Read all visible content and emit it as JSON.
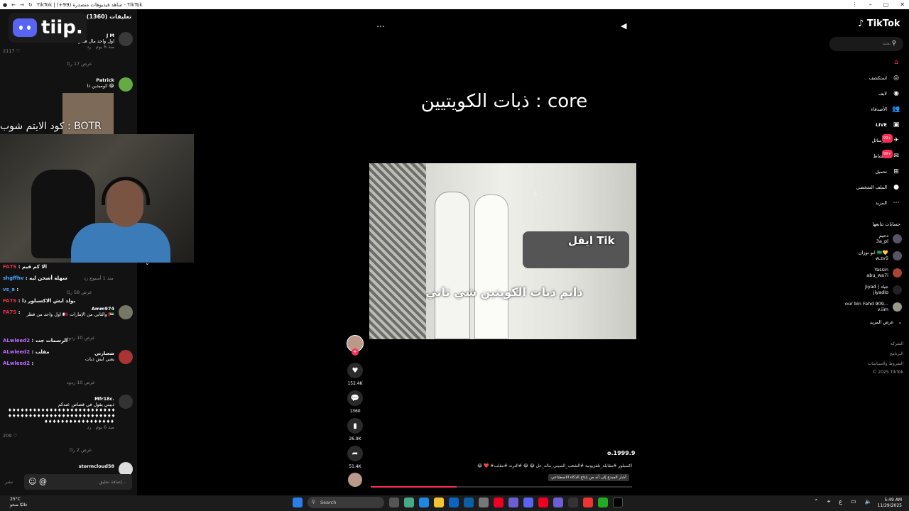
{
  "window": {
    "title": "TikTok | شاهد فيديوهات متصدرة (99+) - TikTok"
  },
  "comments": {
    "header": "تعليقات (1360)",
    "items": [
      {
        "user": "J M",
        "text": "اول واحد مال فطر",
        "time": "منذ 6 يوم",
        "reply": "رد",
        "likes": "2117",
        "view_replies": "عرض 17 ردًا"
      },
      {
        "user": "Patrick",
        "text": "كوميدين ذا 😂",
        "time": "منذ 1 أسبوع",
        "reply": "رد",
        "likes": "",
        "view_replies": "عرض 58 ردًا"
      },
      {
        "user": "Amm974",
        "text": "اول واحد من قطر 🇶🇦 والثاني من الإمارات 🇦🇪",
        "time": "منذ",
        "reply": "رد",
        "likes": "",
        "view_replies": "عرض 10 ردود"
      },
      {
        "user": "شعبارتي",
        "text": "يعني ايش ذبات",
        "time": "منذ",
        "reply": "رد",
        "likes": "",
        "view_replies": "عرض 10 ردود"
      },
      {
        "user": "Mfr18c.",
        "text": "ذيبتي يقول في قصاص عندكم",
        "time": "منذ 6 يوم",
        "reply": "رد",
        "likes": "209",
        "view_replies": "عرض 2 ردًا"
      },
      {
        "user": "stormcloud58",
        "text": "",
        "time": "",
        "reply": "",
        "likes": "",
        "view_replies": ""
      }
    ],
    "input_placeholder": "إضافة تعليق...",
    "post_label": "نشر"
  },
  "overlay": {
    "logo_text": "tiip.",
    "code_text": "كود الايتم شوب : BOTR"
  },
  "chat": [
    {
      "user": "FA7S",
      "msg": "الا كم قيم",
      "color": "red"
    },
    {
      "user": "shgffhv",
      "msg": "سهلة أشحن ليه",
      "color": "blu"
    },
    {
      "user": "vs_a",
      "msg": "",
      "color": "blu"
    },
    {
      "user": "FA7S",
      "msg": "يولد ايش الاكسبلور ذا",
      "color": "red"
    },
    {
      "user": "FA7S",
      "msg": "",
      "color": "red"
    },
    {
      "user": "ALwleed2",
      "msg": "الرسمات جت",
      "color": "pur"
    },
    {
      "user": "ALwleed2",
      "msg": "مقلب",
      "color": "pur"
    },
    {
      "user": "ALwleed2",
      "msg": "",
      "color": "pur"
    }
  ],
  "video": {
    "title": "ذبات الكويتيين : core",
    "caption_top": "ايقل Tik",
    "caption_main": "دايم ذبات الكويتين شي ثاني",
    "author": "o.1999.9",
    "description": "😂 ❤️ #اكسبلور #مقابلة_تلفزيونية #الشعب_الصيني_ماله_حل 😂 😂 #الترند #مقلب",
    "ai_label": "أشار المبدع إلى أنه من إنتاج الذكاء الاصطناعي",
    "likes": "152.4K",
    "comments": "1360",
    "saves": "26.9K",
    "shares": "51.4K",
    "progress": 0.33
  },
  "sidebar": {
    "brand": "TikTok",
    "search_placeholder": "بحث",
    "nav": [
      {
        "label": "",
        "icon": "home-icon"
      },
      {
        "label": "استكشف",
        "icon": "compass-icon"
      },
      {
        "label": "لايف",
        "icon": "live-avatar-icon"
      },
      {
        "label": "الأصدقاء",
        "icon": "friends-icon"
      },
      {
        "label": "LIVE",
        "icon": "live-icon"
      },
      {
        "label": "الرسائل",
        "icon": "messages-icon",
        "badge": "99+"
      },
      {
        "label": "النشاط",
        "icon": "activity-icon",
        "badge": "99+"
      },
      {
        "label": "تحميل",
        "icon": "upload-icon"
      },
      {
        "label": "الملف الشخصي",
        "icon": "profile-icon"
      },
      {
        "label": "المزيد",
        "icon": "more-icon"
      }
    ],
    "following_header": "حسابات تتابعها",
    "following": [
      {
        "name": "دحيم",
        "handle": "3a_pl"
      },
      {
        "name": "ابو نوزان 🇸🇦💛",
        "handle": "w.zv5"
      },
      {
        "name": "Yassin",
        "handle": "abu_wa7i"
      },
      {
        "name": "Jiyad | جياد",
        "handle": "jiyadlo"
      },
      {
        "name": "our bin Fahd 909...",
        "handle": "v.iim"
      }
    ],
    "see_more": "عرض المزيد",
    "footer": [
      "الشركة",
      "البرنامج",
      "الشروط والسياسات",
      "© 2025 TikTok"
    ]
  },
  "taskbar": {
    "temp": "25°C",
    "weather": "غالبًا صحو",
    "search": "Search",
    "time": "5:49 AM",
    "date": "11/29/2025"
  }
}
